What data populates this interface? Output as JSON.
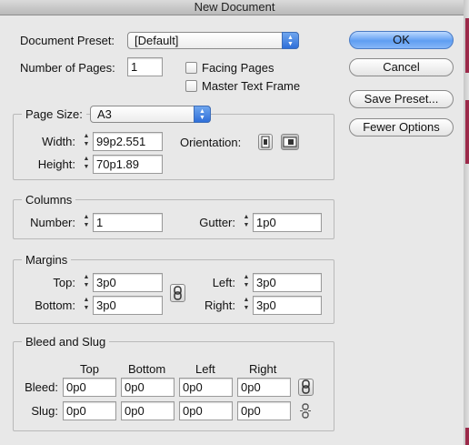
{
  "window": {
    "title": "New Document"
  },
  "preset": {
    "label": "Document Preset:",
    "value": "[Default]"
  },
  "pages": {
    "label": "Number of Pages:",
    "value": "1"
  },
  "facing_pages": {
    "label": "Facing Pages",
    "checked": false
  },
  "master_text_frame": {
    "label": "Master Text Frame",
    "checked": false
  },
  "buttons": {
    "ok": "OK",
    "cancel": "Cancel",
    "save_preset": "Save Preset...",
    "fewer_options": "Fewer Options"
  },
  "page_size": {
    "label": "Page Size:",
    "value": "A3",
    "width_label": "Width:",
    "width_value": "99p2.551",
    "height_label": "Height:",
    "height_value": "70p1.89",
    "orientation_label": "Orientation:",
    "orientation_selected": "landscape"
  },
  "columns": {
    "title": "Columns",
    "number_label": "Number:",
    "number_value": "1",
    "gutter_label": "Gutter:",
    "gutter_value": "1p0"
  },
  "margins": {
    "title": "Margins",
    "top_label": "Top:",
    "top_value": "3p0",
    "bottom_label": "Bottom:",
    "bottom_value": "3p0",
    "left_label": "Left:",
    "left_value": "3p0",
    "right_label": "Right:",
    "right_value": "3p0"
  },
  "bleed_slug": {
    "title": "Bleed and Slug",
    "col_top": "Top",
    "col_bottom": "Bottom",
    "col_left": "Left",
    "col_right": "Right",
    "bleed_label": "Bleed:",
    "slug_label": "Slug:",
    "bleed": {
      "top": "0p0",
      "bottom": "0p0",
      "left": "0p0",
      "right": "0p0"
    },
    "slug": {
      "top": "0p0",
      "bottom": "0p0",
      "left": "0p0",
      "right": "0p0"
    }
  },
  "colors": {
    "accent": "#3e7fe6",
    "window_bg": "#e8e8e8"
  }
}
